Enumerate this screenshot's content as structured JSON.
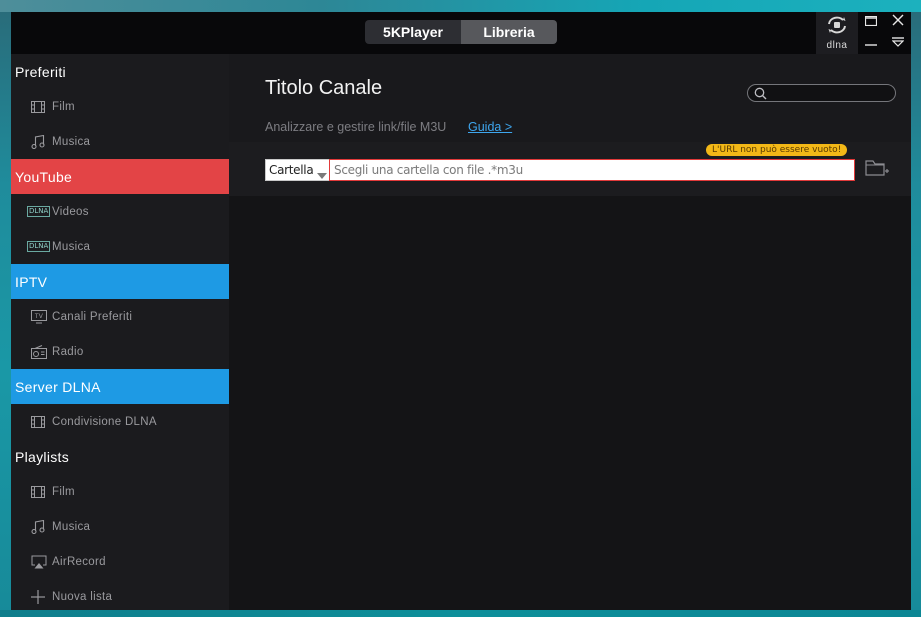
{
  "topbar": {
    "tabs": [
      {
        "label": "5KPlayer",
        "active": false
      },
      {
        "label": "Libreria",
        "active": true
      }
    ],
    "dlna_label": "dlna"
  },
  "sidebar": {
    "sections": {
      "preferiti": "Preferiti",
      "youtube": "YouTube",
      "iptv": "IPTV",
      "server_dlna": "Server DLNA",
      "playlists": "Playlists"
    },
    "items": {
      "fav_film": "Film",
      "fav_musica": "Musica",
      "yt_videos": "Videos",
      "yt_musica": "Musica",
      "iptv_canali": "Canali Preferiti",
      "iptv_radio": "Radio",
      "dlna_condivisione": "Condivisione DLNA",
      "pl_film": "Film",
      "pl_musica": "Musica",
      "pl_airrecord": "AirRecord",
      "pl_nuova": "Nuova lista"
    },
    "dlna_chip": "DLNA",
    "colors": {
      "youtube": "#e34446",
      "iptv": "#1e9ae4",
      "server_dlna": "#1e9ae4"
    }
  },
  "main": {
    "title": "Titolo Canale",
    "subtitle": "Analizzare e gestire link/file M3U",
    "guide_link": "Guida >",
    "search": {
      "value": "",
      "placeholder": ""
    },
    "source_select": {
      "selected": "Cartella"
    },
    "path_input": {
      "value": "",
      "placeholder": "Scegli una cartella con file .*m3u"
    },
    "error_message": "L'URL non può essere vuoto!"
  }
}
